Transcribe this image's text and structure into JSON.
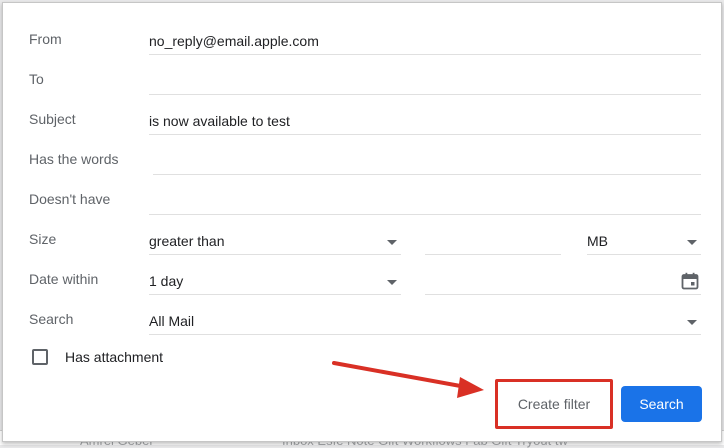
{
  "filter": {
    "from": {
      "label": "From",
      "value": "no_reply@email.apple.com"
    },
    "to": {
      "label": "To",
      "value": ""
    },
    "subject": {
      "label": "Subject",
      "value": "is now available to test"
    },
    "has_words": {
      "label": "Has the words",
      "value": ""
    },
    "doesnt_have": {
      "label": "Doesn't have",
      "value": ""
    },
    "size": {
      "label": "Size",
      "operator": "greater than",
      "value": "",
      "unit": "MB"
    },
    "date_within": {
      "label": "Date within",
      "value": "1 day",
      "date": ""
    },
    "search": {
      "label": "Search",
      "value": "All Mail"
    },
    "has_attachment": {
      "label": "Has attachment",
      "checked": false
    }
  },
  "buttons": {
    "create_filter": "Create filter",
    "search": "Search"
  },
  "colors": {
    "primary": "#1a73e8",
    "highlight": "#d93025"
  },
  "icons": {
    "dropdown": "chevron-down-icon",
    "calendar": "calendar-icon",
    "arrow": "annotation-arrow"
  }
}
